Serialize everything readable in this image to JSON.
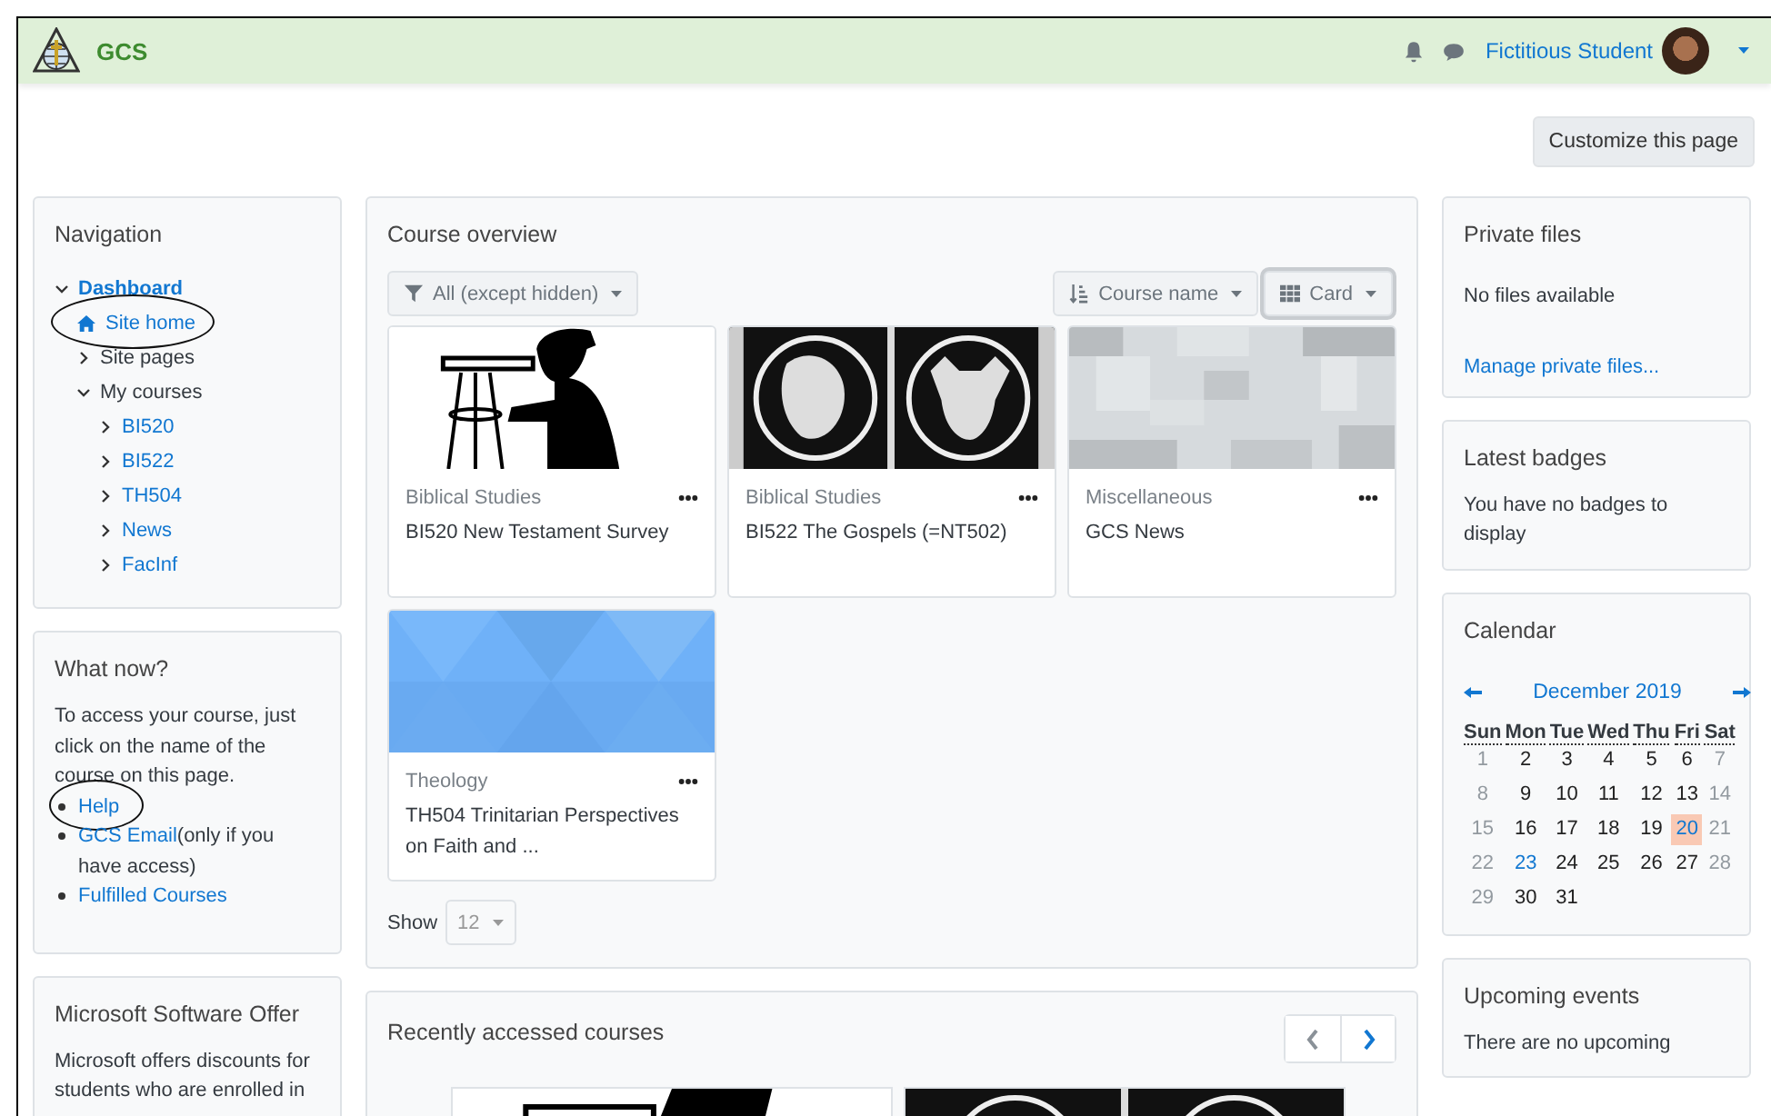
{
  "navbar": {
    "brand": "GCS",
    "user": "Fictitious Student"
  },
  "customize_button": "Customize this page",
  "navigation": {
    "title": "Navigation",
    "items": [
      {
        "label": "Dashboard",
        "kind": "branch",
        "link": true,
        "bold": true,
        "expanded": true,
        "circled": false,
        "children": [
          {
            "label": "Site home",
            "kind": "home",
            "link": true,
            "bold": false,
            "circled": true
          },
          {
            "label": "Site pages",
            "kind": "branch",
            "link": false,
            "bold": false,
            "expanded": false,
            "circled": false
          },
          {
            "label": "My courses",
            "kind": "branch",
            "link": false,
            "bold": false,
            "expanded": true,
            "circled": false,
            "children": [
              {
                "label": "BI520",
                "kind": "branch",
                "link": true,
                "bold": false,
                "expanded": false,
                "circled": false
              },
              {
                "label": "BI522",
                "kind": "branch",
                "link": true,
                "bold": false,
                "expanded": false,
                "circled": false
              },
              {
                "label": "TH504",
                "kind": "branch",
                "link": true,
                "bold": false,
                "expanded": false,
                "circled": false
              },
              {
                "label": "News",
                "kind": "branch",
                "link": true,
                "bold": false,
                "expanded": false,
                "circled": false
              },
              {
                "label": "FacInf",
                "kind": "branch",
                "link": true,
                "bold": false,
                "expanded": false,
                "circled": false
              }
            ]
          }
        ]
      }
    ]
  },
  "what_now": {
    "title": "What now?",
    "text": "To access your course, just click on the name of the course on this page.",
    "links": [
      {
        "label": "Help",
        "circled": true
      },
      {
        "label": "GCS Email",
        "note": "(only if you have access)",
        "circled": false
      },
      {
        "label": "Fulfilled Courses",
        "circled": false
      }
    ]
  },
  "microsoft_offer": {
    "title": "Microsoft Software Offer",
    "text": "Microsoft offers discounts for students who are enrolled in"
  },
  "course_overview": {
    "title": "Course overview",
    "filter": "All (except hidden)",
    "sort": "Course name",
    "view": "Card",
    "courses": [
      {
        "category": "Biblical Studies",
        "name": "BI520 New Testament Survey"
      },
      {
        "category": "Biblical Studies",
        "name": "BI522 The Gospels (=NT502)"
      },
      {
        "category": "Miscellaneous",
        "name": "GCS News"
      },
      {
        "category": "Theology",
        "name": "TH504 Trinitarian Perspectives on Faith and ..."
      }
    ],
    "show_label": "Show",
    "show_value": "12"
  },
  "recent": {
    "title": "Recently accessed courses",
    "prev": {
      "disabled": true
    },
    "next": {
      "disabled": false
    }
  },
  "private_files": {
    "title": "Private files",
    "text": "No files available",
    "link": "Manage private files..."
  },
  "badges": {
    "title": "Latest badges",
    "text": "You have no badges to display"
  },
  "calendar": {
    "title": "Calendar",
    "month": "December 2019",
    "weekdays": [
      "Sun",
      "Mon",
      "Tue",
      "Wed",
      "Thu",
      "Fri",
      "Sat"
    ],
    "weeks": [
      [
        {
          "d": "1",
          "kind": "weekend"
        },
        {
          "d": "2",
          "kind": "day"
        },
        {
          "d": "3",
          "kind": "day"
        },
        {
          "d": "4",
          "kind": "day"
        },
        {
          "d": "5",
          "kind": "day"
        },
        {
          "d": "6",
          "kind": "day"
        },
        {
          "d": "7",
          "kind": "weekend"
        }
      ],
      [
        {
          "d": "8",
          "kind": "weekend"
        },
        {
          "d": "9",
          "kind": "day"
        },
        {
          "d": "10",
          "kind": "day"
        },
        {
          "d": "11",
          "kind": "day"
        },
        {
          "d": "12",
          "kind": "day"
        },
        {
          "d": "13",
          "kind": "day"
        },
        {
          "d": "14",
          "kind": "weekend"
        }
      ],
      [
        {
          "d": "15",
          "kind": "weekend"
        },
        {
          "d": "16",
          "kind": "day"
        },
        {
          "d": "17",
          "kind": "day"
        },
        {
          "d": "18",
          "kind": "day"
        },
        {
          "d": "19",
          "kind": "day"
        },
        {
          "d": "20",
          "kind": "today"
        },
        {
          "d": "21",
          "kind": "weekend"
        }
      ],
      [
        {
          "d": "22",
          "kind": "weekend"
        },
        {
          "d": "23",
          "kind": "event"
        },
        {
          "d": "24",
          "kind": "day"
        },
        {
          "d": "25",
          "kind": "day"
        },
        {
          "d": "26",
          "kind": "day"
        },
        {
          "d": "27",
          "kind": "day"
        },
        {
          "d": "28",
          "kind": "weekend"
        }
      ],
      [
        {
          "d": "29",
          "kind": "weekend"
        },
        {
          "d": "30",
          "kind": "day"
        },
        {
          "d": "31",
          "kind": "day"
        }
      ]
    ]
  },
  "upcoming": {
    "title": "Upcoming events",
    "text": "There are no upcoming"
  }
}
